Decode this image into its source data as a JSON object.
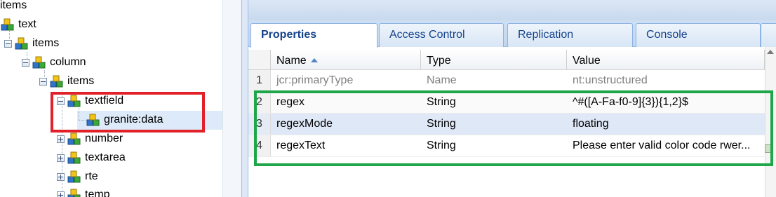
{
  "tree": {
    "root_partial": "items",
    "nodes": [
      {
        "label": "text",
        "expander": "none"
      },
      {
        "label": "items",
        "expander": "minus"
      },
      {
        "label": "column",
        "expander": "minus"
      },
      {
        "label": "items",
        "expander": "minus"
      },
      {
        "label": "textfield",
        "expander": "minus"
      },
      {
        "label": "granite:data",
        "expander": "none",
        "selected": true
      },
      {
        "label": "number",
        "expander": "plus"
      },
      {
        "label": "textarea",
        "expander": "plus"
      },
      {
        "label": "rte",
        "expander": "plus"
      },
      {
        "label": "temp",
        "expander": "plus"
      }
    ],
    "node_icon": "crxde-node-icon"
  },
  "tabs": [
    {
      "label": "Properties",
      "active": true
    },
    {
      "label": "Access Control",
      "active": false
    },
    {
      "label": "Replication",
      "active": false
    },
    {
      "label": "Console",
      "active": false
    }
  ],
  "grid": {
    "headers": {
      "name": "Name",
      "type": "Type",
      "value": "Value"
    },
    "sort_column": "Name",
    "sort_direction": "ascending",
    "rows": [
      {
        "num": "1",
        "name": "jcr:primaryType",
        "type": "Name",
        "value": "nt:unstructured",
        "protected": true
      },
      {
        "num": "2",
        "name": "regex",
        "type": "String",
        "value": "^#([A-Fa-f0-9]{3}){1,2}$"
      },
      {
        "num": "3",
        "name": "regexMode",
        "type": "String",
        "value": "floating",
        "selected": true
      },
      {
        "num": "4",
        "name": "regexText",
        "type": "String",
        "value": "Please enter valid color code rwer..."
      }
    ]
  },
  "annotations": {
    "red_box_color": "#e2202a",
    "green_box_color": "#1fa64a"
  }
}
